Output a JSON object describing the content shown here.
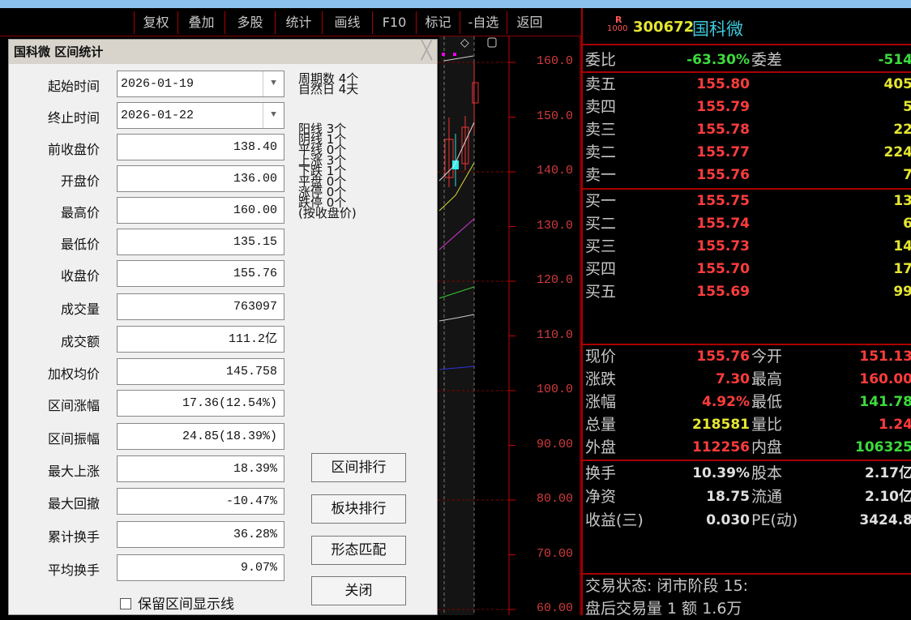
{
  "toolbar": {
    "items": [
      "复权",
      "叠加",
      "多股",
      "统计",
      "画线",
      "F10",
      "标记",
      "-自选",
      "返回"
    ]
  },
  "chart": {
    "price_ticks": [
      "160.0",
      "150.0",
      "140.0",
      "130.0",
      "120.0",
      "110.0",
      "100.0",
      "90.00",
      "80.00",
      "70.00",
      "60.00"
    ]
  },
  "dialog": {
    "title": "国科微 区间统计",
    "fields": [
      {
        "label": "起始时间",
        "value": "2026-01-19"
      },
      {
        "label": "终止时间",
        "value": "2026-01-22"
      },
      {
        "label": "前收盘价",
        "value": "138.40"
      },
      {
        "label": "开盘价",
        "value": "136.00"
      },
      {
        "label": "最高价",
        "value": "160.00"
      },
      {
        "label": "最低价",
        "value": "135.15"
      },
      {
        "label": "收盘价",
        "value": "155.76"
      },
      {
        "label": "成交量",
        "value": "763097"
      },
      {
        "label": "成交额",
        "value": "111.2亿"
      },
      {
        "label": "加权均价",
        "value": "145.758"
      },
      {
        "label": "区间涨幅",
        "value": "17.36(12.54%)"
      },
      {
        "label": "区间振幅",
        "value": "24.85(18.39%)"
      },
      {
        "label": "最大上涨",
        "value": "18.39%"
      },
      {
        "label": "最大回撤",
        "value": "-10.47%"
      },
      {
        "label": "累计换手",
        "value": "36.28%"
      },
      {
        "label": "平均换手",
        "value": "9.07%"
      }
    ],
    "period_stats": [
      "周期数 4个",
      "自然日 4天"
    ],
    "candle_stats": [
      "阳线 3个",
      "阴线 1个",
      "平线 0个",
      "上涨 3个",
      "下跌 1个",
      "平盘 0个",
      "涨停 0个",
      "跌停 0个",
      "(按收盘价)"
    ],
    "buttons": {
      "range_rank": "区间排行",
      "sector_rank": "板块排行",
      "pattern_match": "形态匹配",
      "close": "关闭"
    },
    "keep_lines_label": "保留区间显示线",
    "keep_lines_checked": false
  },
  "quote": {
    "badge_top": "R",
    "badge_bottom": "1000",
    "code": "300672",
    "name": "国科微",
    "weibi": {
      "label": "委比",
      "value": "-63.30%",
      "label2": "委差",
      "value2": "-514"
    },
    "asks": [
      {
        "label": "卖五",
        "price": "155.80",
        "vol": "405"
      },
      {
        "label": "卖四",
        "price": "155.79",
        "vol": "5"
      },
      {
        "label": "卖三",
        "price": "155.78",
        "vol": "22"
      },
      {
        "label": "卖二",
        "price": "155.77",
        "vol": "224"
      },
      {
        "label": "卖一",
        "price": "155.76",
        "vol": "7"
      }
    ],
    "bids": [
      {
        "label": "买一",
        "price": "155.75",
        "vol": "13"
      },
      {
        "label": "买二",
        "price": "155.74",
        "vol": "6"
      },
      {
        "label": "买三",
        "price": "155.73",
        "vol": "14"
      },
      {
        "label": "买四",
        "price": "155.70",
        "vol": "17"
      },
      {
        "label": "买五",
        "price": "155.69",
        "vol": "99"
      }
    ],
    "stats1": [
      {
        "l1": "现价",
        "v1": "155.76",
        "c1": "red",
        "l2": "今开",
        "v2": "151.13",
        "c2": "red"
      },
      {
        "l1": "涨跌",
        "v1": "7.30",
        "c1": "red",
        "l2": "最高",
        "v2": "160.00",
        "c2": "red"
      },
      {
        "l1": "涨幅",
        "v1": "4.92%",
        "c1": "red",
        "l2": "最低",
        "v2": "141.78",
        "c2": "green"
      },
      {
        "l1": "总量",
        "v1": "218581",
        "c1": "yellow",
        "l2": "量比",
        "v2": "1.24",
        "c2": "red"
      },
      {
        "l1": "外盘",
        "v1": "112256",
        "c1": "red",
        "l2": "内盘",
        "v2": "106325",
        "c2": "green"
      }
    ],
    "stats2": [
      {
        "l1": "换手",
        "v1": "10.39%",
        "c1": "white",
        "l2": "股本",
        "v2": "2.17亿",
        "c2": "white"
      },
      {
        "l1": "净资",
        "v1": "18.75",
        "c1": "white",
        "l2": "流通",
        "v2": "2.10亿",
        "c2": "white"
      },
      {
        "l1": "收益(三)",
        "v1": "0.030",
        "c1": "white",
        "l2": "PE(动)",
        "v2": "3424.8",
        "c2": "white"
      }
    ],
    "trade_status": "交易状态: 闭市阶段 15:",
    "after_hours": "盘后交易量 1 额 1.6万"
  }
}
